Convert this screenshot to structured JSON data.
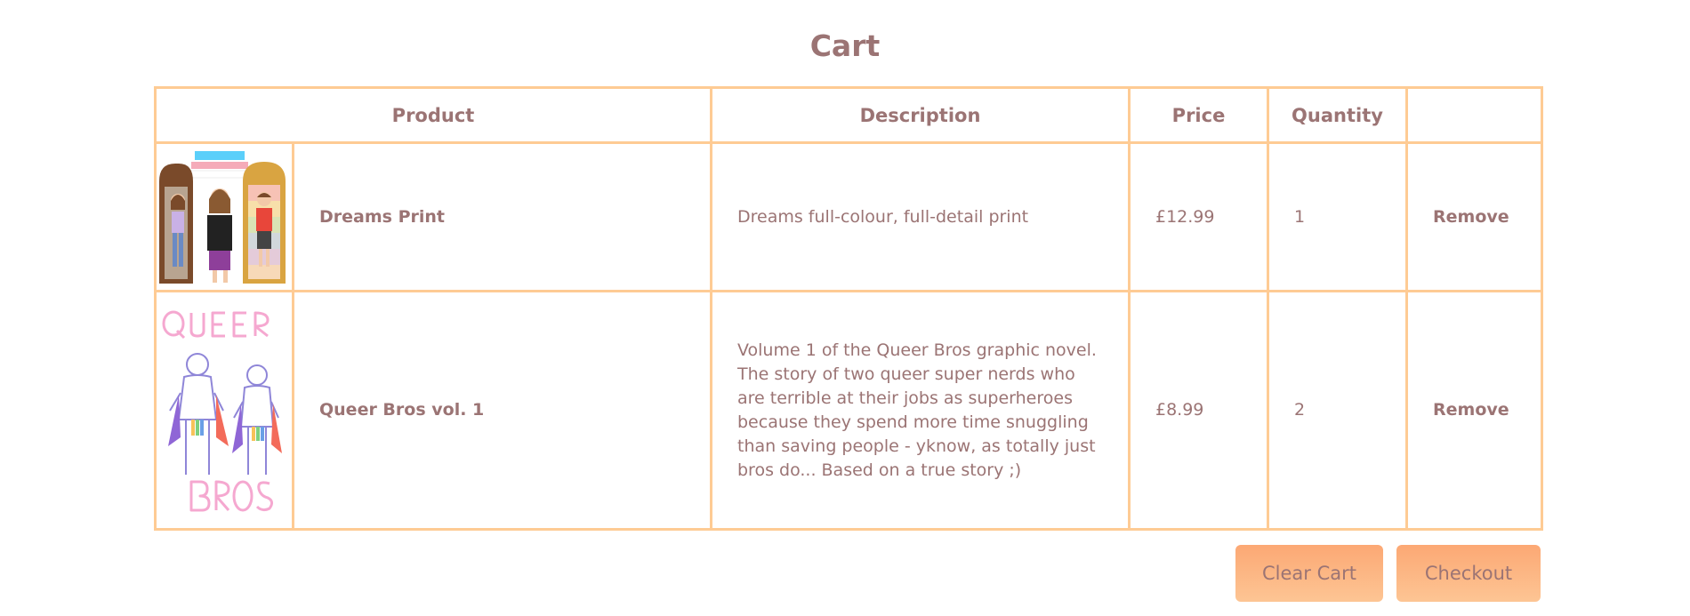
{
  "page": {
    "title": "Cart"
  },
  "table": {
    "headers": [
      "Product",
      "Description",
      "Price",
      "Quantity",
      ""
    ]
  },
  "items": [
    {
      "name": "Dreams Print",
      "description": "Dreams full-colour, full-detail print",
      "price": "£12.99",
      "quantity": "1",
      "remove_label": "Remove"
    },
    {
      "name": "Queer Bros vol. 1",
      "description": "Volume 1 of the Queer Bros graphic novel. The story of two queer super nerds who are terrible at their jobs as superheroes because they spend more time snuggling than saving people - yknow, as totally just bros do... Based on a true story ;)",
      "price": "£8.99",
      "quantity": "2",
      "remove_label": "Remove"
    }
  ],
  "actions": {
    "clear_label": "Clear Cart",
    "checkout_label": "Checkout"
  },
  "colors": {
    "text": "#9b7474",
    "border": "#fecb94",
    "button_top": "#fca874",
    "button_bottom": "#fdc594"
  }
}
